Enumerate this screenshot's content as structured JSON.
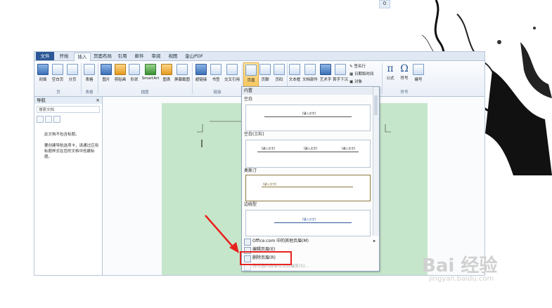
{
  "badge": "0",
  "tabs": [
    "文件",
    "开始",
    "插入",
    "页面布局",
    "引用",
    "邮件",
    "审阅",
    "视图",
    "金山PDF"
  ],
  "ribbon": {
    "buttons": [
      "封面",
      "空白页",
      "分页",
      "表格",
      "图片",
      "剪贴画",
      "形状",
      "SmartArt",
      "图表",
      "屏幕截图",
      "超链接",
      "书签",
      "交叉引用",
      "页眉",
      "页脚",
      "页码",
      "文本框",
      "文档部件",
      "艺术字",
      "首字下沉",
      "公式",
      "符号",
      "编号"
    ],
    "side_items": [
      "签名行",
      "日期和时间",
      "对象"
    ],
    "groups": [
      "页",
      "表格",
      "插图",
      "链接",
      "符号"
    ]
  },
  "nav": {
    "title": "导航",
    "close": "×",
    "search_placeholder": "搜索文档",
    "msg1": "此文档不包含标题。",
    "msg2": "要创建导航选项卡，请通过应用标题样式在您的文档中创建标题。"
  },
  "menu": {
    "header": "内置",
    "sections": [
      "空白",
      "空白(三栏)",
      "奥斯汀",
      "边线型"
    ],
    "placeholder": "[键入文字]",
    "items": [
      "Office.com 中的其他页眉(M)",
      "编辑页眉(E)",
      "删除页眉(R)",
      "将所选内容保存到页眉库(S)..."
    ]
  },
  "watermark": {
    "brand": "Bai 经验",
    "url": "jingyan.baidu.com"
  }
}
